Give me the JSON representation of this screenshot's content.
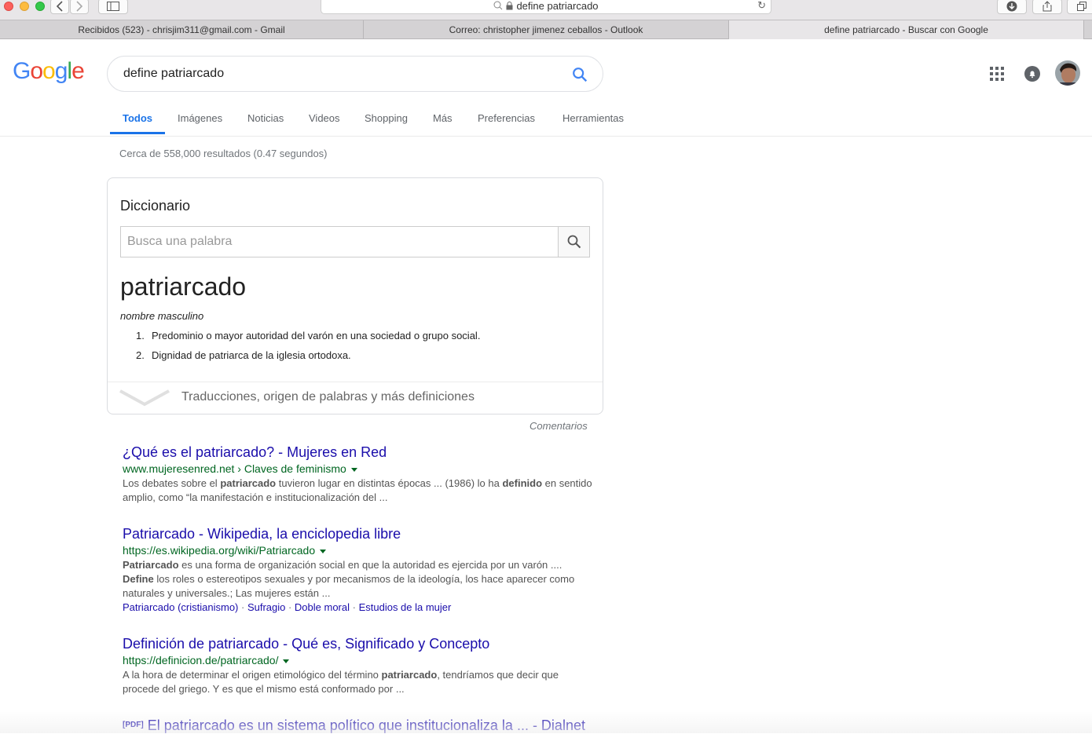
{
  "browser": {
    "address": "define patriarcado",
    "tabs": [
      {
        "label": "Recibidos (523) - chrisjim311@gmail.com - Gmail",
        "active": false
      },
      {
        "label": "Correo: christopher jimenez ceballos - Outlook",
        "active": false
      },
      {
        "label": "define patriarcado - Buscar con Google",
        "active": true
      }
    ]
  },
  "google": {
    "logo": [
      "G",
      "o",
      "o",
      "g",
      "l",
      "e"
    ],
    "logo_colors": [
      "#4285f4",
      "#ea4335",
      "#fbbc05",
      "#4285f4",
      "#34a853",
      "#ea4335"
    ],
    "query": "define patriarcado",
    "nav": [
      "Todos",
      "Imágenes",
      "Noticias",
      "Videos",
      "Shopping",
      "Más",
      "Preferencias",
      "Herramientas"
    ],
    "stats": "Cerca de 558,000 resultados (0.47 segundos)"
  },
  "dictionary": {
    "title": "Diccionario",
    "input_placeholder": "Busca una palabra",
    "word": "patriarcado",
    "pos": "nombre masculino",
    "definitions": [
      {
        "num": "1.",
        "text": "Predominio o mayor autoridad del varón en una sociedad o grupo social."
      },
      {
        "num": "2.",
        "text": "Dignidad de patriarca de la iglesia ortodoxa."
      }
    ],
    "footer": "Traducciones, origen de palabras y más definiciones",
    "comments": "Comentarios"
  },
  "results": [
    {
      "title": "¿Qué es el patriarcado? - Mujeres en Red",
      "url": "www.mujeresenred.net › Claves de feminismo",
      "snippet_parts": [
        "Los debates sobre el ",
        "patriarcado",
        " tuvieron lugar en distintas épocas ... (1986) lo ha ",
        "definido",
        " en sentido amplio, como “la manifestación e institucionalización del ..."
      ]
    },
    {
      "title": "Patriarcado - Wikipedia, la enciclopedia libre",
      "url": "https://es.wikipedia.org/wiki/Patriarcado",
      "snippet_parts": [
        "Patriarcado",
        " es una forma de organización social en que la autoridad es ejercida por un varón .... ",
        "Define",
        " los roles o estereotipos sexuales y por mecanismos de la ideología, los hace aparecer como naturales y universales.; Las mujeres están  ..."
      ],
      "sitelinks": [
        "Patriarcado (cristianismo)",
        "Sufragio",
        "Doble moral",
        "Estudios de la mujer"
      ]
    },
    {
      "title": "Definición de patriarcado - Qué es, Significado y Concepto",
      "url": "https://definicion.de/patriarcado/",
      "snippet_parts": [
        "A la hora de determinar el origen etimológico del término ",
        "patriarcado",
        ", tendríamos que decir que procede del griego. Y es que el mismo está conformado por ..."
      ]
    },
    {
      "tag": "[PDF]",
      "title": "El patriarcado es un sistema político que institucionaliza la ... - Dialnet"
    }
  ],
  "colors": {
    "link": "#1a0dab",
    "url": "#006621",
    "accent": "#1a73e8"
  }
}
